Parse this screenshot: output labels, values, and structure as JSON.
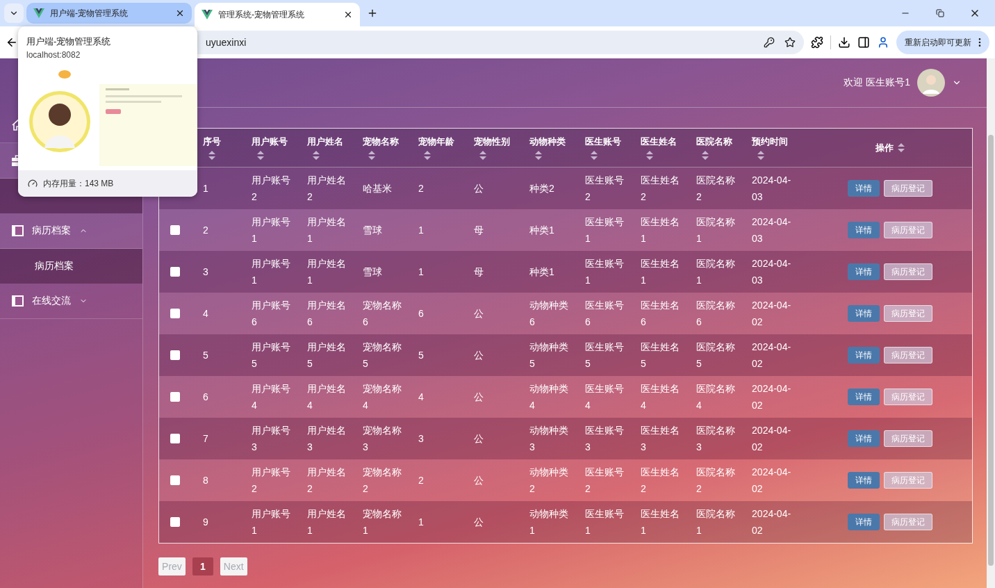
{
  "browser": {
    "tabs": [
      {
        "title": "用户端-宠物管理系统",
        "selected": false
      },
      {
        "title": "管理系统-宠物管理系统",
        "selected": true
      }
    ],
    "address": "uyuexinxi",
    "update_button": "重新启动即可更新",
    "hover_card": {
      "title": "用户端-宠物管理系统",
      "url": "localhost:8082",
      "memory": "内存用量：143 MB"
    }
  },
  "header": {
    "welcome": "欢迎 医生账号1"
  },
  "sidebar": {
    "items": [
      {
        "kind": "home"
      },
      {
        "kind": "briefcase",
        "expanded": true,
        "children": [
          {
            "kind": "item"
          }
        ]
      },
      {
        "kind": "panel",
        "label": "病历档案",
        "expanded": true,
        "children": [
          {
            "kind": "item",
            "label": "病历档案"
          }
        ]
      },
      {
        "kind": "panel",
        "label": "在线交流",
        "expanded": false
      }
    ]
  },
  "table": {
    "columns": [
      {
        "label": "序号",
        "kind": "stacked"
      },
      {
        "label": "用户账号",
        "kind": "stacked"
      },
      {
        "label": "用户姓名",
        "kind": "stacked"
      },
      {
        "label": "宠物名称",
        "kind": "stacked"
      },
      {
        "label": "宠物年龄",
        "kind": "stacked"
      },
      {
        "label": "宠物性别",
        "kind": "stacked"
      },
      {
        "label": "动物种类",
        "kind": "stacked"
      },
      {
        "label": "医生账号",
        "kind": "stacked"
      },
      {
        "label": "医生姓名",
        "kind": "stacked"
      },
      {
        "label": "医院名称",
        "kind": "stacked"
      },
      {
        "label": "预约时间",
        "kind": "stacked"
      },
      {
        "label": "操作",
        "kind": "inline"
      }
    ],
    "rows": [
      {
        "cells": [
          "1",
          "用户账号2",
          "用户姓名2",
          "哈基米",
          "2",
          "公",
          "种类2",
          "医生账号2",
          "医生姓名2",
          "医院名称2",
          "2024-04-03"
        ],
        "actions": [
          "详情",
          "病历登记"
        ]
      },
      {
        "checked": false,
        "cells": [
          "2",
          "用户账号1",
          "用户姓名1",
          "雪球",
          "1",
          "母",
          "种类1",
          "医生账号1",
          "医生姓名1",
          "医院名称1",
          "2024-04-03"
        ],
        "actions": [
          "详情",
          "病历登记"
        ]
      },
      {
        "checked": false,
        "cells": [
          "3",
          "用户账号1",
          "用户姓名1",
          "雪球",
          "1",
          "母",
          "种类1",
          "医生账号1",
          "医生姓名1",
          "医院名称1",
          "2024-04-03"
        ],
        "actions": [
          "详情",
          "病历登记"
        ]
      },
      {
        "checked": false,
        "cells": [
          "4",
          "用户账号6",
          "用户姓名6",
          "宠物名称6",
          "6",
          "公",
          "动物种类6",
          "医生账号6",
          "医生姓名6",
          "医院名称6",
          "2024-04-02"
        ],
        "actions": [
          "详情",
          "病历登记"
        ]
      },
      {
        "checked": false,
        "cells": [
          "5",
          "用户账号5",
          "用户姓名5",
          "宠物名称5",
          "5",
          "公",
          "动物种类5",
          "医生账号5",
          "医生姓名5",
          "医院名称5",
          "2024-04-02"
        ],
        "actions": [
          "详情",
          "病历登记"
        ]
      },
      {
        "checked": false,
        "cells": [
          "6",
          "用户账号4",
          "用户姓名4",
          "宠物名称4",
          "4",
          "公",
          "动物种类4",
          "医生账号4",
          "医生姓名4",
          "医院名称4",
          "2024-04-02"
        ],
        "actions": [
          "详情",
          "病历登记"
        ]
      },
      {
        "checked": false,
        "cells": [
          "7",
          "用户账号3",
          "用户姓名3",
          "宠物名称3",
          "3",
          "公",
          "动物种类3",
          "医生账号3",
          "医生姓名3",
          "医院名称3",
          "2024-04-02"
        ],
        "actions": [
          "详情",
          "病历登记"
        ]
      },
      {
        "checked": false,
        "cells": [
          "8",
          "用户账号2",
          "用户姓名2",
          "宠物名称2",
          "2",
          "公",
          "动物种类2",
          "医生账号2",
          "医生姓名2",
          "医院名称2",
          "2024-04-02"
        ],
        "actions": [
          "详情",
          "病历登记"
        ]
      },
      {
        "checked": false,
        "cells": [
          "9",
          "用户账号1",
          "用户姓名1",
          "宠物名称1",
          "1",
          "公",
          "动物种类1",
          "医生账号1",
          "医生姓名1",
          "医院名称1",
          "2024-04-02"
        ],
        "actions": [
          "详情",
          "病历登记"
        ]
      }
    ]
  },
  "pagination": {
    "prev": "Prev",
    "pages": [
      {
        "label": "1",
        "selected": true
      }
    ],
    "next": "Next"
  }
}
